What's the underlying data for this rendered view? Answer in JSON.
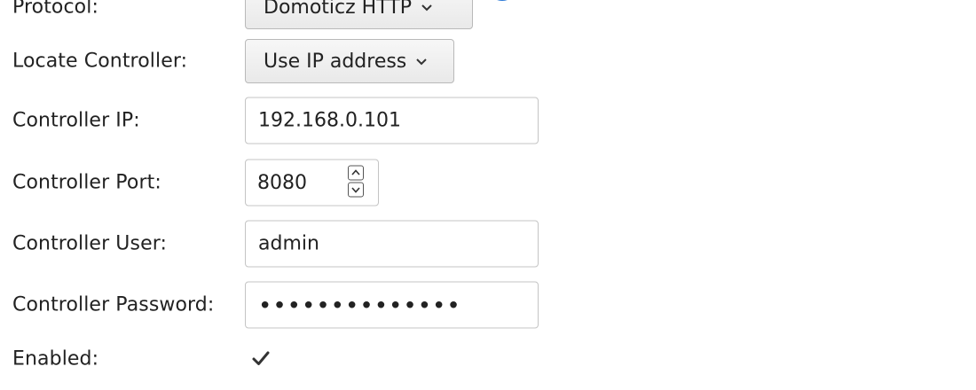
{
  "protocol": {
    "label": "Protocol:",
    "value": "Domoticz HTTP"
  },
  "locate_controller": {
    "label": "Locate Controller:",
    "value": "Use IP address"
  },
  "controller_ip": {
    "label": "Controller IP:",
    "value": "192.168.0.101"
  },
  "controller_port": {
    "label": "Controller Port:",
    "value": "8080"
  },
  "controller_user": {
    "label": "Controller User:",
    "value": "admin"
  },
  "controller_password": {
    "label": "Controller Password:",
    "value": "••••••••••••••"
  },
  "enabled": {
    "label": "Enabled:",
    "checked": true
  },
  "colors": {
    "help_blue": "#2a78d6",
    "text": "#222222",
    "border": "#c4c4c4"
  },
  "icons": {
    "help": "question-mark-icon",
    "dropdown": "chevron-down-icon",
    "spin_up": "chevron-up-icon",
    "spin_down": "chevron-down-icon",
    "check": "checkmark-icon"
  }
}
